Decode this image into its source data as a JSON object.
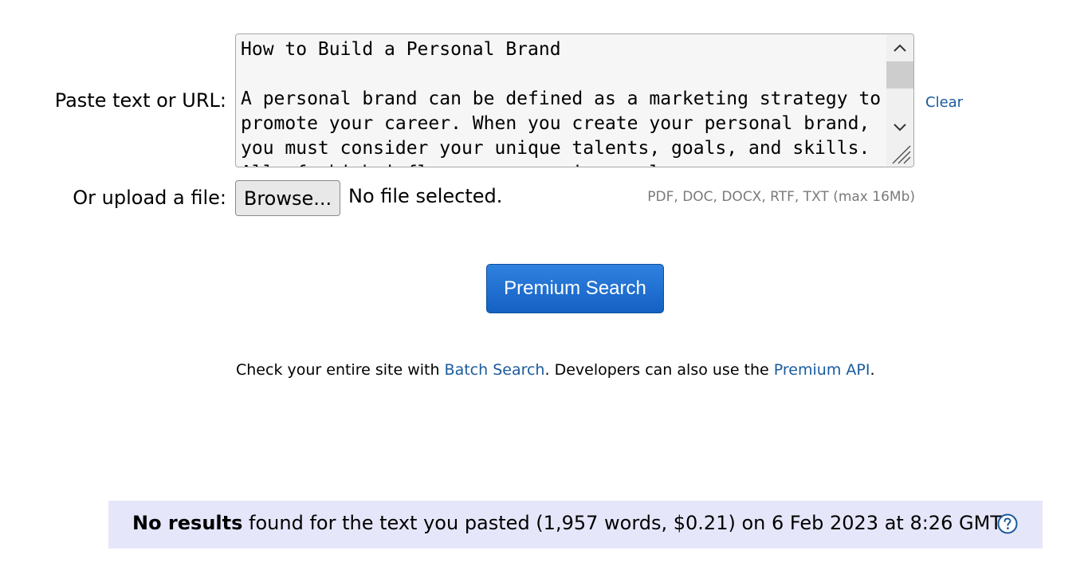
{
  "form": {
    "paste_label": "Paste text or URL:",
    "textarea_text": "How to Build a Personal Brand\n\nA personal brand can be defined as a marketing strategy to promote your career. When you create your personal brand, you must consider your unique talents, goals, and skills. All of which influence your unique value.",
    "clear_label": "Clear",
    "upload_label": "Or upload a file:",
    "browse_label": "Browse...",
    "file_status": "No file selected.",
    "file_types": "PDF, DOC, DOCX, RTF, TXT (max 16Mb)"
  },
  "search": {
    "button_label": "Premium Search"
  },
  "batch": {
    "prefix": "Check your entire site with ",
    "batch_link": "Batch Search",
    "middle": ". Developers can also use the ",
    "api_link": "Premium API",
    "suffix": "."
  },
  "results": {
    "bold": "No results",
    "text": " found for the text you pasted (1,957 words, $0.21) on 6 Feb 2023 at 8:26 GMT."
  },
  "icons": {
    "scroll_up": "chevron-up-icon",
    "scroll_down": "chevron-down-icon",
    "resize": "resize-grip-icon",
    "help": "question-circle-icon"
  },
  "colors": {
    "link": "#1a5a9e",
    "button_top": "#2f82df",
    "button_bottom": "#1560c4",
    "results_bg": "#e6e6fa"
  }
}
